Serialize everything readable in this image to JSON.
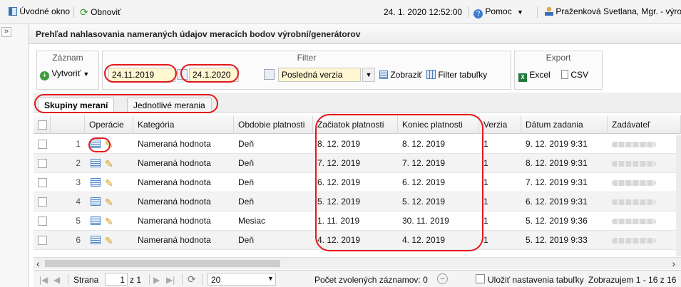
{
  "topbar": {
    "home_label": "Úvodné okno",
    "refresh_label": "Obnoviť",
    "datetime": "24. 1. 2020 12:52:00",
    "help_label": "Pomoc",
    "user_label": "Praženková Svetlana, Mgr. - výrobca"
  },
  "panel": {
    "title": "Prehľad nahlasovania nameraných údajov meracích bodov výrobní/generátorov",
    "record_group": "Záznam",
    "create_label": "Vytvoriť",
    "filter_group": "Filter",
    "date_from": "24.11.2019",
    "date_to": "24.1.2020",
    "version_select": "Posledná verzia",
    "show_label": "Zobraziť",
    "filter_table_label": "Filter tabuľky",
    "export_group": "Export",
    "excel_label": "Excel",
    "csv_label": "CSV"
  },
  "tabs": [
    {
      "label": "Skupiny meraní",
      "active": true
    },
    {
      "label": "Jednotlivé merania",
      "active": false
    }
  ],
  "columns": [
    "Operácie",
    "Kategória",
    "Obdobie platnosti",
    "Začiatok platnosti",
    "Koniec platnosti",
    "Verzia",
    "Dátum zadania",
    "Zadávateľ"
  ],
  "rows": [
    {
      "num": "1",
      "category": "Nameraná hodnota",
      "period": "Deň",
      "start": "8. 12. 2019",
      "end": "8. 12. 2019",
      "version": "1",
      "entered": "9. 12. 2019 9:31"
    },
    {
      "num": "2",
      "category": "Nameraná hodnota",
      "period": "Deň",
      "start": "7. 12. 2019",
      "end": "7. 12. 2019",
      "version": "1",
      "entered": "8. 12. 2019 9:31"
    },
    {
      "num": "3",
      "category": "Nameraná hodnota",
      "period": "Deň",
      "start": "6. 12. 2019",
      "end": "6. 12. 2019",
      "version": "1",
      "entered": "7. 12. 2019 9:31"
    },
    {
      "num": "4",
      "category": "Nameraná hodnota",
      "period": "Deň",
      "start": "5. 12. 2019",
      "end": "5. 12. 2019",
      "version": "1",
      "entered": "6. 12. 2019 9:31"
    },
    {
      "num": "5",
      "category": "Nameraná hodnota",
      "period": "Mesiac",
      "start": "1. 11. 2019",
      "end": "30. 11. 2019",
      "version": "1",
      "entered": "5. 12. 2019 9:36"
    },
    {
      "num": "6",
      "category": "Nameraná hodnota",
      "period": "Deň",
      "start": "4. 12. 2019",
      "end": "4. 12. 2019",
      "version": "1",
      "entered": "5. 12. 2019 9:33"
    }
  ],
  "pager": {
    "page_label": "Strana",
    "page_value": "1",
    "of_label": "z 1",
    "page_size": "20",
    "selected_label": "Počet zvolených záznamov: 0",
    "save_settings_label": "Uložiť nastavenia tabuľky",
    "showing_label": "Zobrazujem 1 - 16 z 16"
  },
  "colors": {
    "highlight_red": "#e4181c",
    "date_bg": "#fff7d1"
  }
}
